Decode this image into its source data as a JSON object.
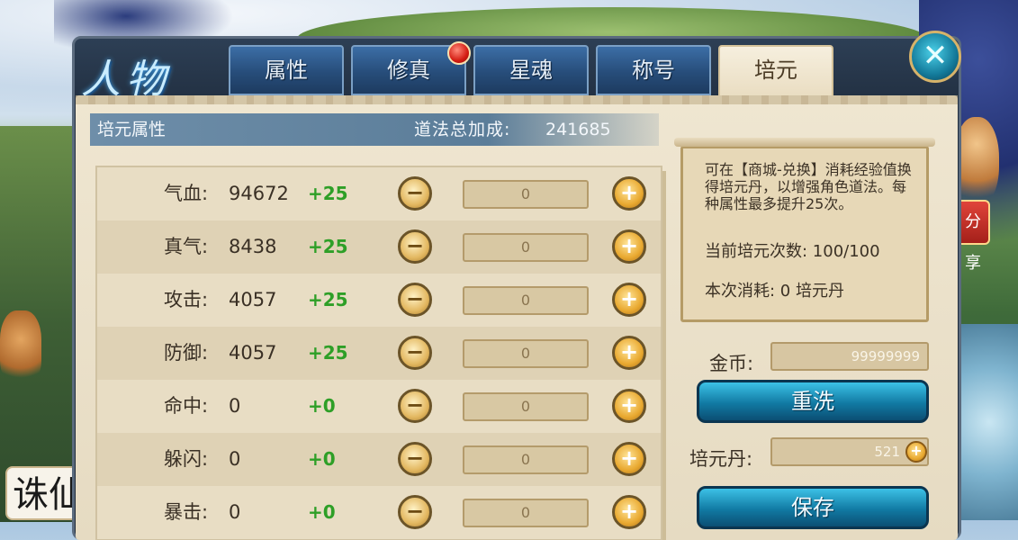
{
  "window": {
    "title": "人物"
  },
  "tabs": [
    {
      "label": "属性",
      "active": false
    },
    {
      "label": "修真",
      "active": false,
      "notification": true
    },
    {
      "label": "星魂",
      "active": false
    },
    {
      "label": "称号",
      "active": false
    },
    {
      "label": "培元",
      "active": true
    }
  ],
  "close_icon": "close-icon",
  "header": {
    "title": "培元属性",
    "bonus_label": "道法总加成:",
    "bonus_value": "241685"
  },
  "attributes": [
    {
      "name": "气血:",
      "value": "94672",
      "bonus": "+25",
      "input": "0"
    },
    {
      "name": "真气:",
      "value": "8438",
      "bonus": "+25",
      "input": "0"
    },
    {
      "name": "攻击:",
      "value": "4057",
      "bonus": "+25",
      "input": "0"
    },
    {
      "name": "防御:",
      "value": "4057",
      "bonus": "+25",
      "input": "0"
    },
    {
      "name": "命中:",
      "value": "0",
      "bonus": "+0",
      "input": "0"
    },
    {
      "name": "躲闪:",
      "value": "0",
      "bonus": "+0",
      "input": "0"
    },
    {
      "name": "暴击:",
      "value": "0",
      "bonus": "+0",
      "input": "0"
    }
  ],
  "info": {
    "text": "可在【商城-兑换】消耗经验值换得培元丹，以增强角色道法。每种属性最多提升25次。",
    "count": "当前培元次数: 100/100",
    "cost": "本次消耗: 0 培元丹"
  },
  "gold": {
    "label": "金币:",
    "value": "99999999"
  },
  "wash_button": "重洗",
  "pill": {
    "label": "培元丹:",
    "value": "521"
  },
  "save_button": "保存",
  "side": {
    "share_label": "分享"
  },
  "game_logo_text": "诛仙",
  "colors": {
    "bonus_green": "#2e9f27",
    "button_blue": "#117aa3",
    "panel_beige": "#efe6d1"
  }
}
